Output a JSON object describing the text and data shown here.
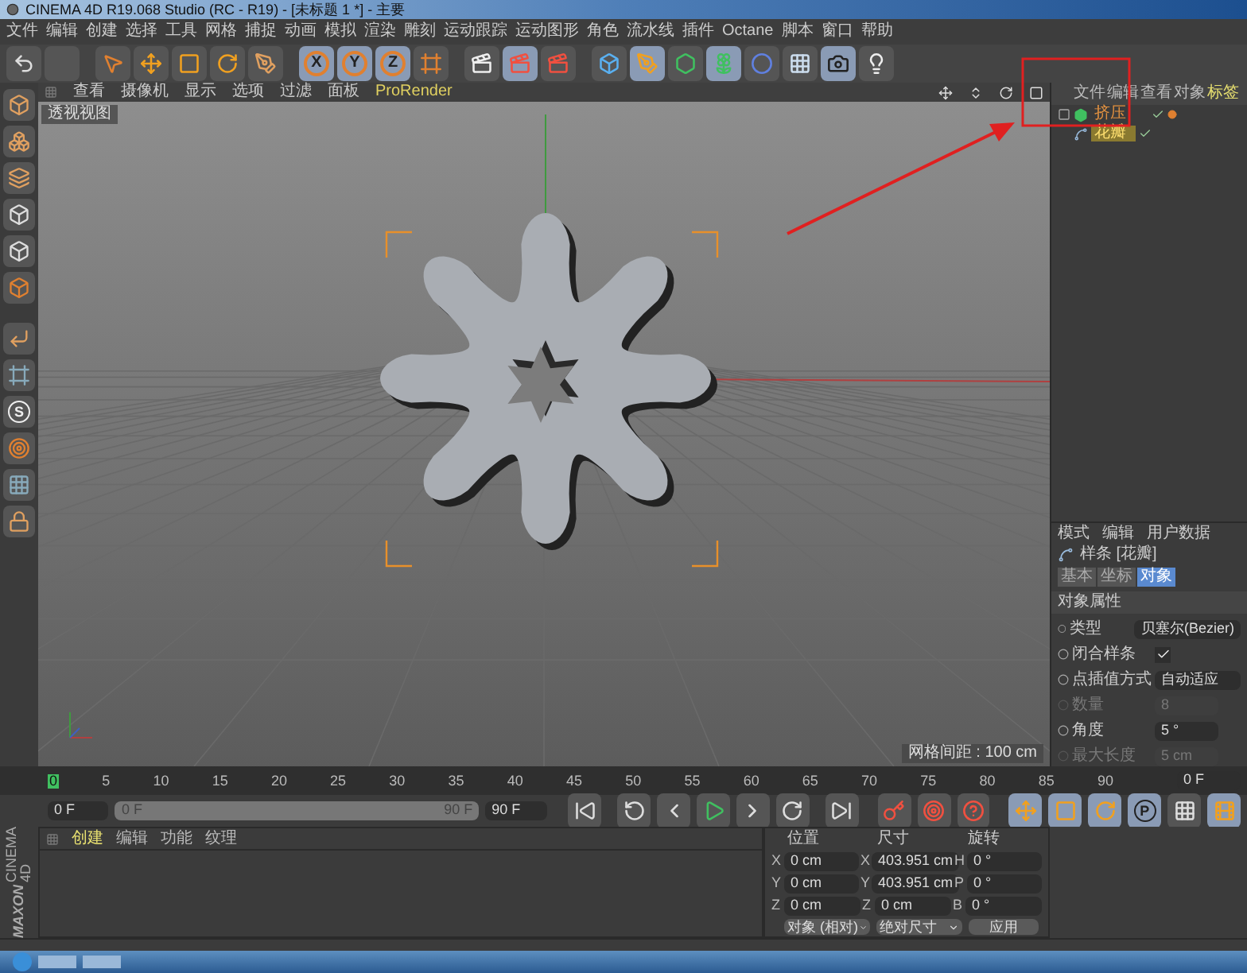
{
  "window": {
    "title": "CINEMA 4D R19.068 Studio (RC - R19) - [未标题 1 *] - 主要"
  },
  "menu": [
    "文件",
    "编辑",
    "创建",
    "选择",
    "工具",
    "网格",
    "捕捉",
    "动画",
    "模拟",
    "渲染",
    "雕刻",
    "运动跟踪",
    "运动图形",
    "角色",
    "流水线",
    "插件",
    "Octane",
    "脚本",
    "窗口",
    "帮助"
  ],
  "toolbar": {
    "axis_buttons": [
      "X",
      "Y",
      "Z"
    ]
  },
  "left_tools": {
    "snap_label": "S"
  },
  "viewport": {
    "menu": [
      "查看",
      "摄像机",
      "显示",
      "选项",
      "过滤",
      "面板",
      "ProRender"
    ],
    "view_label": "透视视图",
    "grid_spacing": "网格间距 : 100 cm"
  },
  "object_manager": {
    "tabs": [
      "文件",
      "编辑",
      "查看",
      "对象",
      "标签"
    ],
    "tree": [
      {
        "name": "挤压",
        "selected": false,
        "children": [
          {
            "name": "花瓣",
            "selected": true
          }
        ]
      }
    ]
  },
  "attributes": {
    "menu": [
      "模式",
      "编辑",
      "用户数据"
    ],
    "object_title": "样条 [花瓣]",
    "tabs": [
      {
        "label": "基本",
        "selected": false
      },
      {
        "label": "坐标",
        "selected": false
      },
      {
        "label": "对象",
        "selected": true
      }
    ],
    "section": "对象属性",
    "fields": [
      {
        "kind": "dropdown",
        "label": "类型",
        "value": "贝塞尔(Bezier)",
        "disabled": false
      },
      {
        "kind": "checkbox",
        "label": "闭合样条",
        "checked": true,
        "disabled": false
      },
      {
        "kind": "dropdown",
        "label": "点插值方式",
        "value": "自动适应",
        "disabled": false
      },
      {
        "kind": "number",
        "label": "数量",
        "value": "8",
        "disabled": true
      },
      {
        "kind": "number",
        "label": "角度",
        "value": "5 °",
        "disabled": false
      },
      {
        "kind": "number",
        "label": "最大长度",
        "value": "5 cm",
        "disabled": true
      }
    ]
  },
  "timeline": {
    "ticks": [
      "0",
      "5",
      "10",
      "15",
      "20",
      "25",
      "30",
      "35",
      "40",
      "45",
      "50",
      "55",
      "60",
      "65",
      "70",
      "75",
      "80",
      "85",
      "90"
    ],
    "current_frame": "0 F"
  },
  "transport": {
    "start": "0 F",
    "level": 1,
    "range_start": "0 F",
    "range_end": "90 F",
    "end": "90 F",
    "param_key_label": "P"
  },
  "materials": {
    "tabs": [
      {
        "label": "创建",
        "selected": true
      },
      {
        "label": "编辑",
        "selected": false
      },
      {
        "label": "功能",
        "selected": false
      },
      {
        "label": "纹理",
        "selected": false
      }
    ]
  },
  "brand": {
    "company": "MAXON",
    "product": "CINEMA 4D"
  },
  "coordinates": {
    "headers": [
      "位置",
      "尺寸",
      "旋转"
    ],
    "rows": [
      {
        "pos_axis": "X",
        "pos": "0 cm",
        "size_axis": "X",
        "size": "403.951 cm",
        "rot_axis": "H",
        "rot": "0 °"
      },
      {
        "pos_axis": "Y",
        "pos": "0 cm",
        "size_axis": "Y",
        "size": "403.951 cm",
        "rot_axis": "P",
        "rot": "0 °"
      },
      {
        "pos_axis": "Z",
        "pos": "0 cm",
        "size_axis": "Z",
        "size": "0 cm",
        "rot_axis": "B",
        "rot": "0 °"
      }
    ],
    "dropdowns": [
      "对象 (相对)",
      "绝对尺寸"
    ],
    "apply": "应用"
  }
}
